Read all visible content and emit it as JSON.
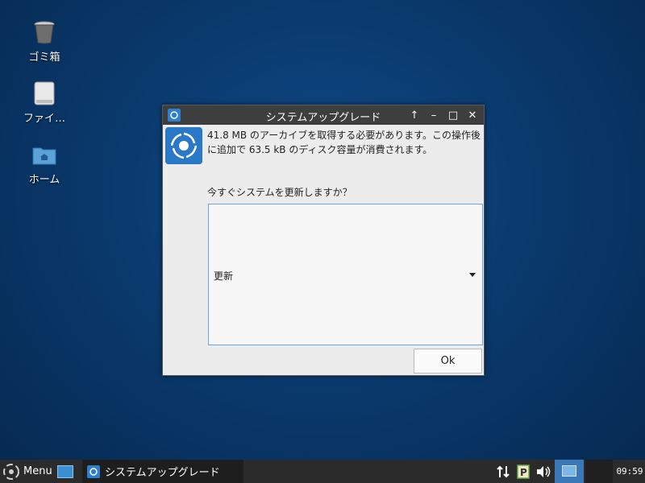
{
  "desktop": {
    "icons": [
      {
        "label": "ゴミ箱",
        "icon": "trash-icon"
      },
      {
        "label": "ファイ…",
        "icon": "drive-icon"
      },
      {
        "label": "ホーム",
        "icon": "home-folder-icon"
      }
    ]
  },
  "dialog": {
    "title": "システムアップグレード",
    "message": "41.8 MB のアーカイブを取得する必要があります。この操作後に追加で 63.5 kB のディスク容量が消費されます。",
    "question": "今すぐシステムを更新しますか？",
    "combo_value": "更新",
    "ok_label": "Ok",
    "controls": [
      "up-arrow-icon",
      "minimize-icon",
      "maximize-icon",
      "close-icon"
    ]
  },
  "taskbar": {
    "menu_label": "Menu",
    "task_label": "システムアップグレード",
    "clock": "09:59"
  },
  "colors": {
    "desktop": "#0a3a6e",
    "titlebar": "#3e3e3e",
    "taskbar": "#2b2b2b",
    "accent": "#3b78b8"
  }
}
